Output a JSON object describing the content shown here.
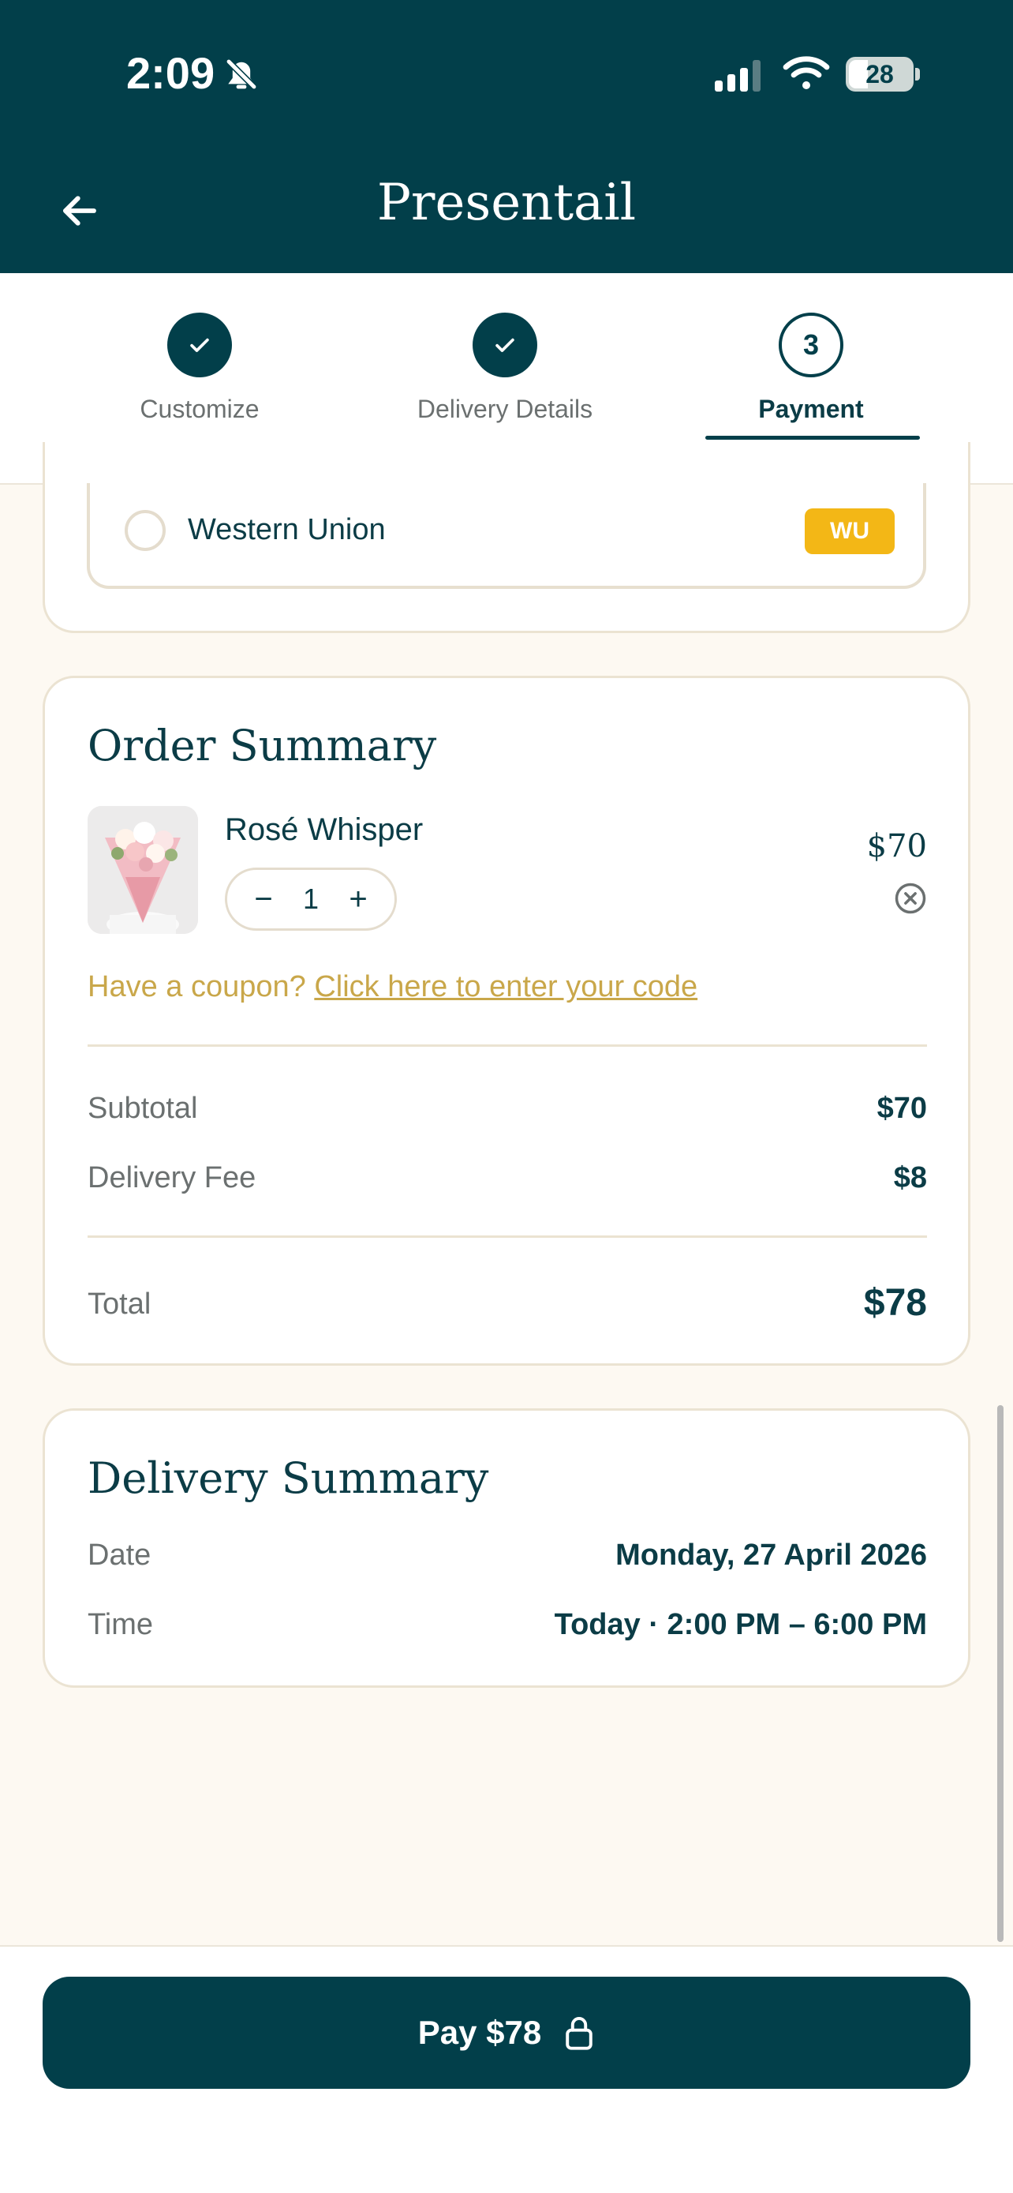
{
  "status_bar": {
    "time": "2:09",
    "battery": "28"
  },
  "header": {
    "title": "Presentail"
  },
  "steps": [
    {
      "label": "Customize",
      "state": "done"
    },
    {
      "label": "Delivery Details",
      "state": "done"
    },
    {
      "label": "Payment",
      "state": "active",
      "number": "3"
    }
  ],
  "payment": {
    "option_label": "Western Union",
    "badge": "WU"
  },
  "order": {
    "title": "Order Summary",
    "item": {
      "name": "Rosé Whisper",
      "price": "$70",
      "quantity": "1"
    },
    "coupon_prompt": "Have a coupon?",
    "coupon_link": "Click here to enter your code",
    "subtotal_label": "Subtotal",
    "subtotal_value": "$70",
    "delivery_fee_label": "Delivery Fee",
    "delivery_fee_value": "$8",
    "total_label": "Total",
    "total_value": "$78"
  },
  "delivery": {
    "title": "Delivery Summary",
    "date_label": "Date",
    "date_value": "Monday, 27 April 2026",
    "time_label": "Time",
    "time_value": "Today · 2:00 PM – 6:00 PM"
  },
  "footer": {
    "pay_label": "Pay $78"
  },
  "colors": {
    "primary": "#023f4a",
    "accent": "#c9a74a",
    "badge": "#f3b716",
    "background": "#fdf9f2"
  }
}
